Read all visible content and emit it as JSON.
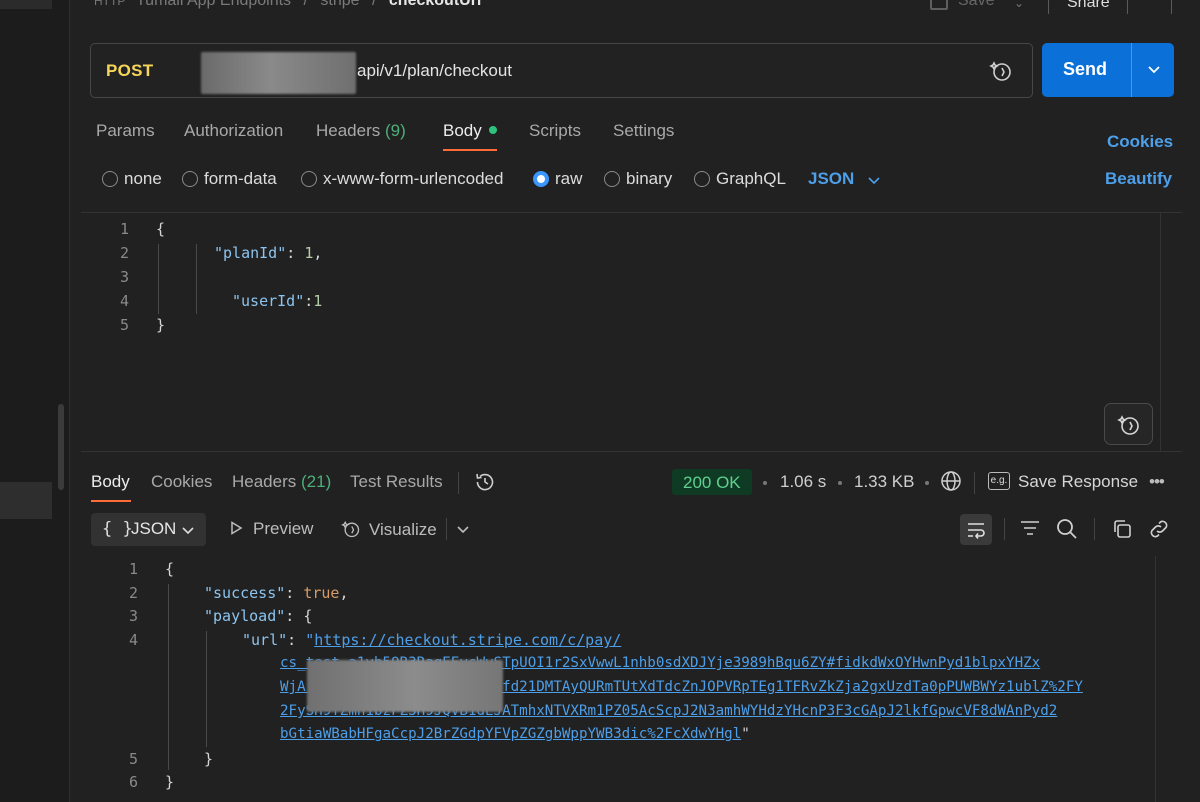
{
  "breadcrumb": {
    "collection": "Tumali App Endpoints",
    "folder": "stripe",
    "request": "checkoutUrl",
    "sep": "/"
  },
  "toolbar": {
    "save_label": "Save",
    "share_label": "Share"
  },
  "request": {
    "method": "POST",
    "url_path": "api/v1/plan/checkout",
    "send_label": "Send"
  },
  "request_tabs": [
    {
      "label": "Params"
    },
    {
      "label": "Authorization"
    },
    {
      "label": "Headers",
      "count": "(9)"
    },
    {
      "label": "Body"
    },
    {
      "label": "Scripts"
    },
    {
      "label": "Settings"
    }
  ],
  "cookies_label": "Cookies",
  "beautify_label": "Beautify",
  "body_types": [
    "none",
    "form-data",
    "x-www-form-urlencoded",
    "raw",
    "binary",
    "GraphQL"
  ],
  "body_type_selected": "raw",
  "body_language": "JSON",
  "request_body": {
    "line_numbers": [
      "1",
      "2",
      "3",
      "4",
      "5"
    ],
    "open": "{",
    "key1": "\"planId\"",
    "colon1": ": ",
    "val1": "1",
    "comma1": ",",
    "key2": "\"userId\"",
    "colon2": ":",
    "val2": "1",
    "close": "}"
  },
  "response_tabs": [
    {
      "label": "Body"
    },
    {
      "label": "Cookies"
    },
    {
      "label": "Headers",
      "count": "(21)"
    },
    {
      "label": "Test Results"
    }
  ],
  "response_meta": {
    "status": "200 OK",
    "time": "1.06 s",
    "size": "1.33 KB",
    "save_response_label": "Save Response",
    "eg_label": "e.g."
  },
  "response_toolbar": {
    "format": "JSON",
    "braces": "{ }",
    "preview_label": "Preview",
    "visualize_label": "Visualize"
  },
  "response_body": {
    "line_numbers": [
      "1",
      "2",
      "3",
      "4",
      "5",
      "6"
    ],
    "open": "{",
    "success_key": "\"success\"",
    "success_val": "true",
    "payload_key": "\"payload\"",
    "payload_open": "{",
    "url_key": "\"url\"",
    "url_quote_open": "\"",
    "url_lines": [
      "https://checkout.stripe.com/c/pay/",
      "cs_test_a1vb5QR3RagEEycWySTpUOI1r2SxVwwL1nhb0sdXDJYje3989hBqu6ZY#fidkdWxOYHwnPyd1blpxYHZx",
      "WjA                       fd21DMTAyQURmTUtXdTdcZnJOPVRpTEg1TFRvZkZja2gxUzdTa0pPUWBWYz1ublZ%2FY",
      "2FySH9YZmh1bzFZ3H9JQVB1dEJATmhxNTVXRm1PZ05AcScpJ2N3amhWYHdzYHcnP3F3cGApJ2lkfGpwcVF8dWAnPyd2",
      "bGtiaWBabHFgaCcpJ2BrZGdpYFVpZGZgbWppYWB3dic%2FcXdwYHgl"
    ],
    "url_quote_close": "\"",
    "payload_close": "}",
    "close": "}"
  },
  "colors": {
    "accent": "#0b71d8",
    "method": "#f5d55a",
    "tab_indicator": "#ff6c37",
    "status_ok": "#5fd08f",
    "link": "#4d9fea"
  }
}
